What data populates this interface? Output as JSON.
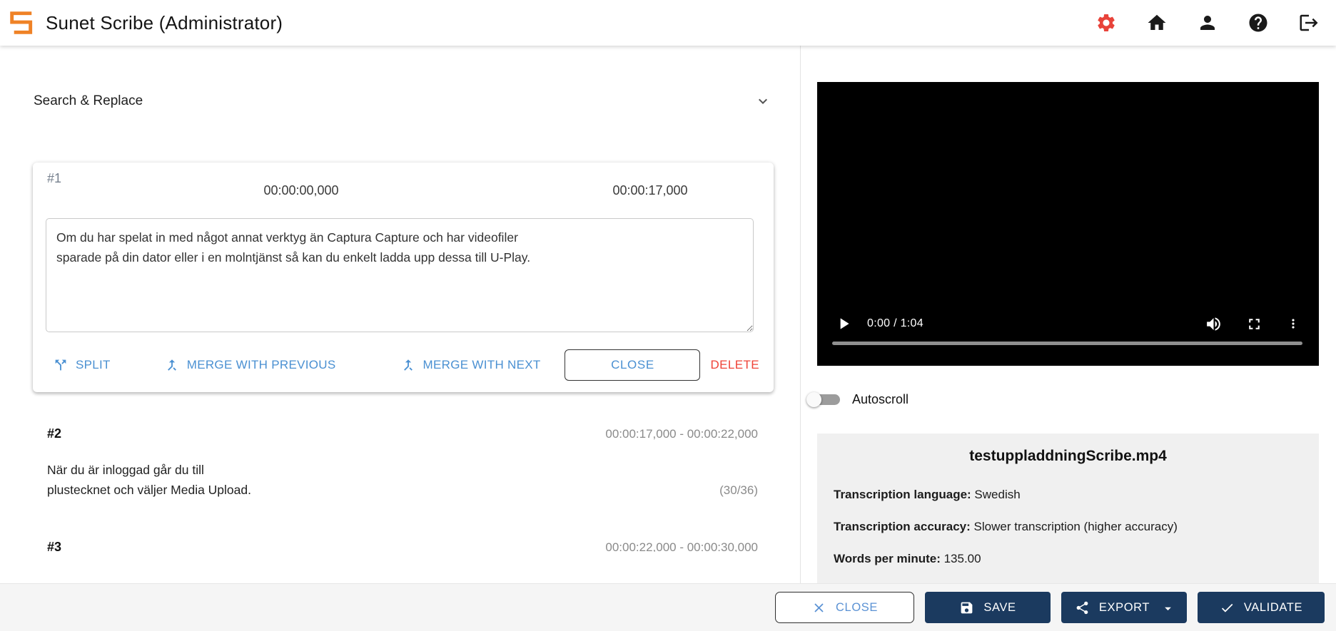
{
  "header": {
    "title": "Sunet Scribe (Administrator)",
    "icons": [
      "settings-icon",
      "home-icon",
      "person-icon",
      "help-icon",
      "logout-icon"
    ]
  },
  "search_replace": {
    "label": "Search & Replace"
  },
  "editor": {
    "segment_id": "#1",
    "start_time": "00:00:00,000",
    "end_time": "00:00:17,000",
    "text": "Om du har spelat in med något annat verktyg än Captura Capture och har videofiler\nsparade på din dator eller i en molntjänst så kan du enkelt ladda upp dessa till U-Play.",
    "split_label": "SPLIT",
    "merge_previous_label": "MERGE WITH PREVIOUS",
    "merge_next_label": "MERGE WITH NEXT",
    "close_label": "CLOSE",
    "delete_label": "DELETE"
  },
  "segments": [
    {
      "id": "#2",
      "time_range": "00:00:17,000 - 00:00:22,000",
      "text": "När du är inloggad går du till\nplustecknet och väljer Media Upload.",
      "counter": "(30/36)"
    },
    {
      "id": "#3",
      "time_range": "00:00:22,000 - 00:00:30,000"
    }
  ],
  "video": {
    "time_display": "0:00 / 1:04",
    "current_time": "0:00",
    "duration": "1:04"
  },
  "autoscroll": {
    "label": "Autoscroll",
    "enabled": false
  },
  "file_info": {
    "filename": "testuppladdningScribe.mp4",
    "rows": [
      {
        "label": "Transcription language:",
        "value": " Swedish"
      },
      {
        "label": "Transcription accuracy:",
        "value": " Slower transcription (higher accuracy)"
      },
      {
        "label": "Words per minute:",
        "value": " 135.00"
      }
    ]
  },
  "footer": {
    "close_label": "CLOSE",
    "save_label": "SAVE",
    "export_label": "EXPORT",
    "validate_label": "VALIDATE"
  },
  "colors": {
    "brand_orange": "#ef8226",
    "settings_red": "#e8433a",
    "action_blue": "#4a90d2",
    "navy": "#1b3a5f",
    "delete_red": "#ef4337"
  }
}
